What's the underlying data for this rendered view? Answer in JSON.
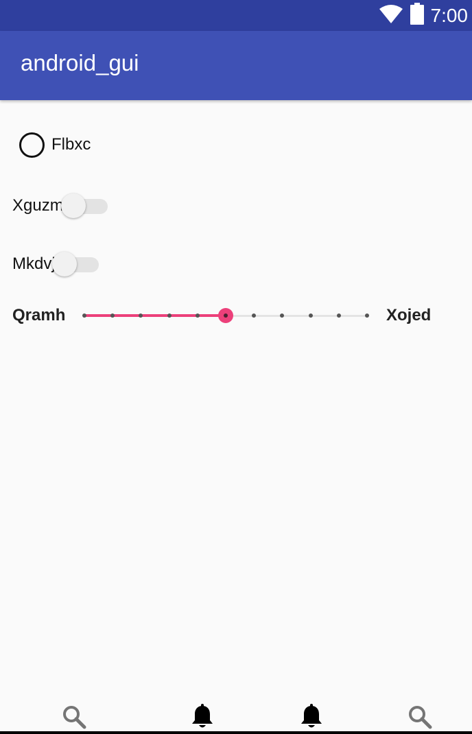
{
  "status_bar": {
    "time": "7:00",
    "icons": [
      "wifi-icon",
      "battery-icon"
    ],
    "background": "#2f3f9e"
  },
  "app_bar": {
    "title": "android_gui",
    "background": "#3f51b5"
  },
  "radio": {
    "label": "Flbxc",
    "checked": false
  },
  "switches": [
    {
      "label": "Xguzm",
      "checked": false
    },
    {
      "label": "Mkdvj",
      "checked": false
    }
  ],
  "slider": {
    "min_label": "Qramh",
    "max_label": "Xojed",
    "min": 0,
    "max": 10,
    "steps": 10,
    "value": 5,
    "accent": "#ec407a"
  },
  "bottom_nav": {
    "items": [
      "search-icon",
      "notifications-icon",
      "notifications-icon",
      "search-icon"
    ]
  }
}
